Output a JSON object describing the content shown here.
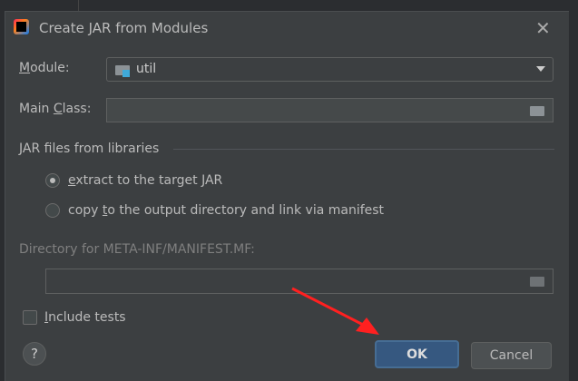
{
  "dialog": {
    "title": "Create JAR from Modules"
  },
  "module": {
    "label_u": "M",
    "label_rest": "odule:",
    "value": "util"
  },
  "main_class": {
    "label_pre": "Main ",
    "label_u": "C",
    "label_rest": "lass:",
    "value": ""
  },
  "libraries": {
    "heading": "JAR files from libraries",
    "options": [
      {
        "pre": "",
        "u": "e",
        "rest": "xtract to the target JAR",
        "selected": true
      },
      {
        "pre": "copy ",
        "u": "t",
        "rest": "o the output directory and link via manifest",
        "selected": false
      }
    ]
  },
  "manifest": {
    "label": "Directory for META-INF/MANIFEST.MF:",
    "value": ""
  },
  "include_tests": {
    "u": "I",
    "rest": "nclude tests",
    "checked": false
  },
  "buttons": {
    "help": "?",
    "ok": "OK",
    "cancel": "Cancel"
  },
  "colors": {
    "accent": "#365880",
    "annotation_arrow": "#ff2020"
  }
}
